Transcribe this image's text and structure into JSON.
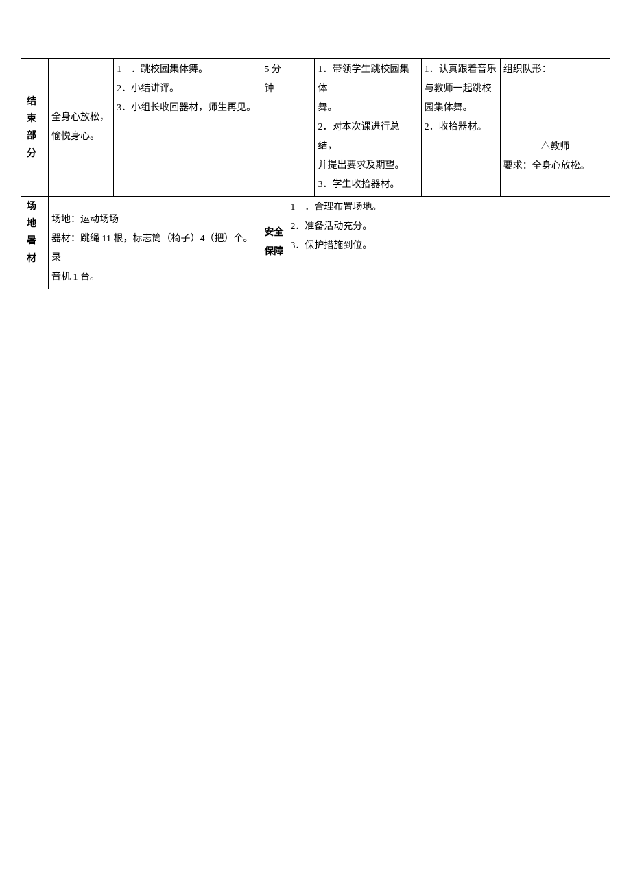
{
  "row1": {
    "section_label_l1": "结",
    "section_label_l2": "束",
    "section_label_l3": "部",
    "section_label_l4": "分",
    "goal_l1": "全身心放松，",
    "goal_l2": "愉悦身心。",
    "content_l1": "1　．跳校园集体舞。",
    "content_l2": "2．小结讲评。",
    "content_l3": "3．小组长收回器材，师生再见。",
    "time_l1": "5 分",
    "time_l2": "钟",
    "teacher_activity_l1": "1．带领学生跳校园集体",
    "teacher_activity_l2": "舞。",
    "teacher_activity_l3": "2．对本次课进行总结，",
    "teacher_activity_l4": "并提出要求及期望。",
    "teacher_activity_l5": "3．学生收拾器材。",
    "student_activity_l1": "1．认真跟着音乐",
    "student_activity_l2": "与教师一起跳校",
    "student_activity_l3": "园集体舞。",
    "student_activity_l4": "2．收拾器材。",
    "formation_l1": "组织队形：",
    "formation_l2": "△教师",
    "formation_l3": "要求：全身心放松。"
  },
  "row2": {
    "section_label_l1": "场",
    "section_label_l2": "地",
    "section_label_l3": "暑",
    "section_label_l4": "材",
    "venue_l1": "场地：运动场场",
    "venue_l2": "器材：跳绳 11 根，标志筒（椅子）4（把）个。录",
    "venue_l3": "音机 1 台。",
    "safety_label_l1": "安全",
    "safety_label_l2": "保障",
    "safety_l1": "1　．合理布置场地。",
    "safety_l2": "2．准备活动充分。",
    "safety_l3": "3．保护措施到位。"
  }
}
